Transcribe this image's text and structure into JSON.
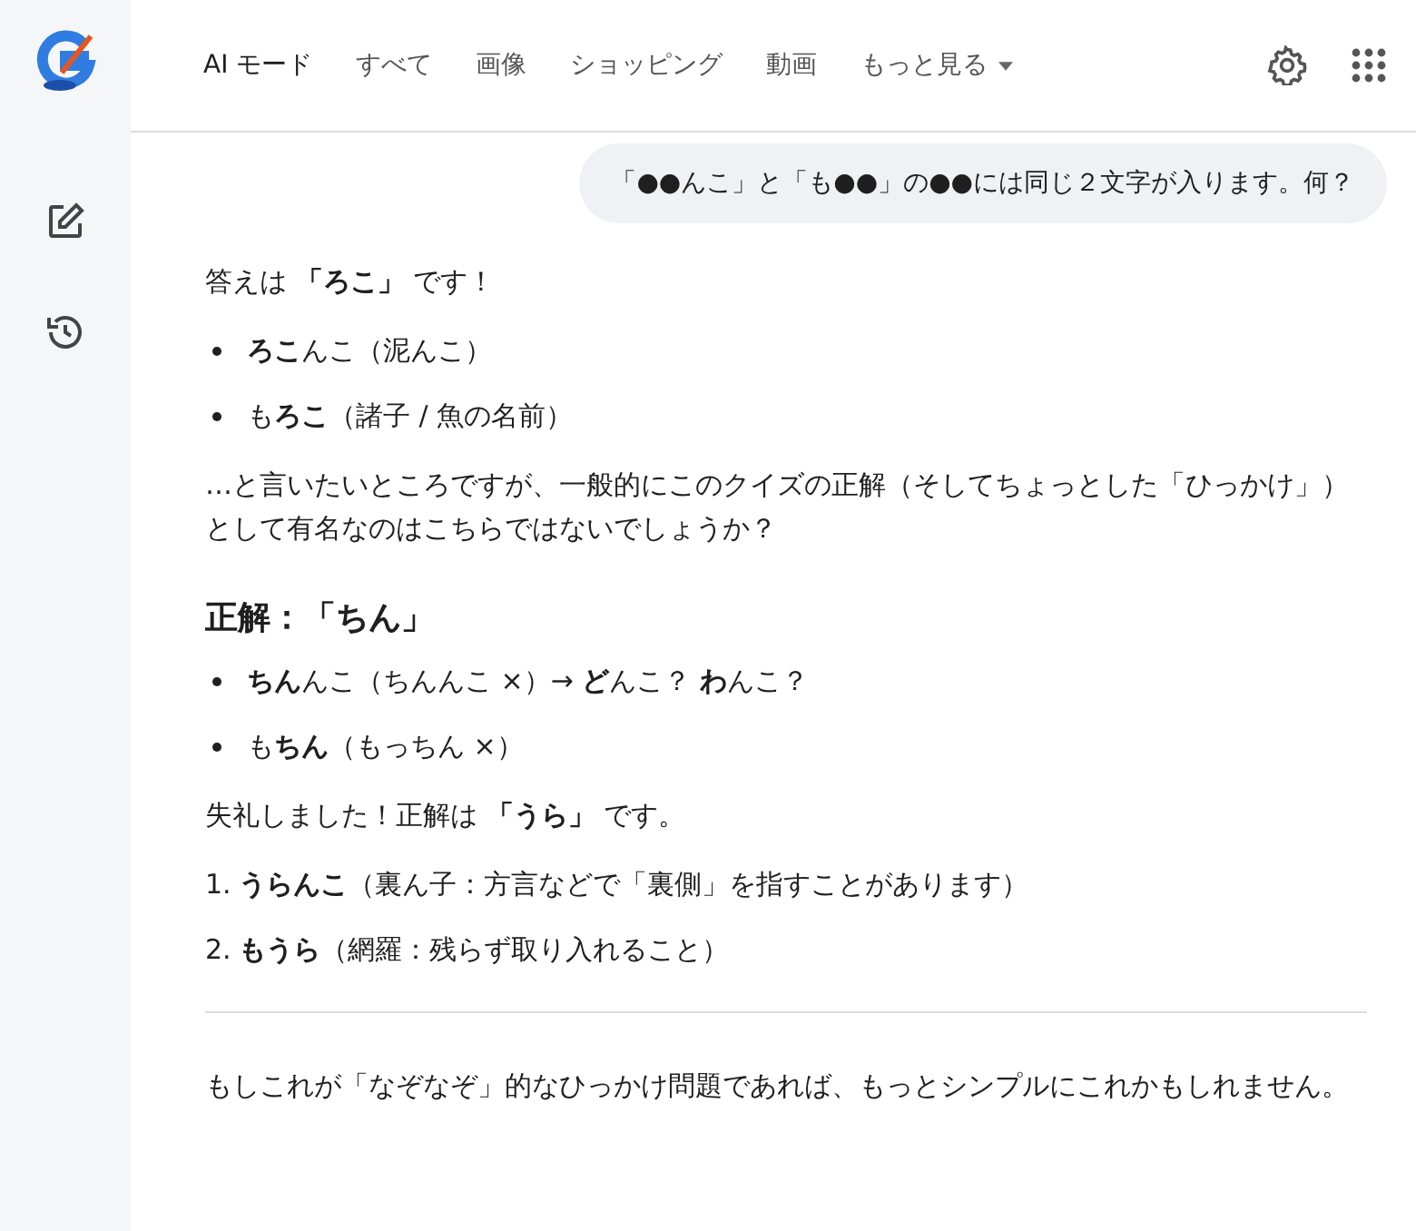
{
  "tabs": [
    {
      "label": "AI モード",
      "selected": true
    },
    {
      "label": "すべて",
      "selected": false
    },
    {
      "label": "画像",
      "selected": false
    },
    {
      "label": "ショッピング",
      "selected": false
    },
    {
      "label": "動画",
      "selected": false
    },
    {
      "label": "もっと見る",
      "selected": false,
      "dropdown": true
    }
  ],
  "query": "「●●んこ」と「も●●」の●●には同じ２文字が入ります。何？",
  "blocks": [
    {
      "kind": "paragraph",
      "text": "答えは **「ろこ」** です！"
    },
    {
      "kind": "bullets",
      "items": [
        "**ろこ**んこ（泥んこ）",
        "も**ろこ**（諸子 / 魚の名前）"
      ]
    },
    {
      "kind": "paragraph",
      "text": "…と言いたいところですが、一般的にこのクイズの正解（そしてちょっとした「ひっかけ」）として有名なのはこちらではないでしょうか？"
    },
    {
      "kind": "heading",
      "text": "正解：「ちん」"
    },
    {
      "kind": "bullets",
      "items": [
        "**ちん**んこ（ちんんこ ×）→ **ど**んこ？ **わ**んこ？",
        "も**ちん**（もっちん ×）"
      ]
    },
    {
      "kind": "paragraph",
      "text": "失礼しました！正解は **「うら」** です。"
    },
    {
      "kind": "numbered",
      "items": [
        {
          "number": "1.",
          "text": "**うらんこ**（裏ん子：方言などで「裏側」を指すことがあります）"
        },
        {
          "number": "2.",
          "text": "**もうら**（網羅：残らず取り入れること）"
        }
      ]
    },
    {
      "kind": "divider"
    },
    {
      "kind": "paragraph",
      "text": "もしこれが「なぞなぞ」的なひっかけ問題であれば、もっとシンプルにこれかもしれません。"
    }
  ]
}
